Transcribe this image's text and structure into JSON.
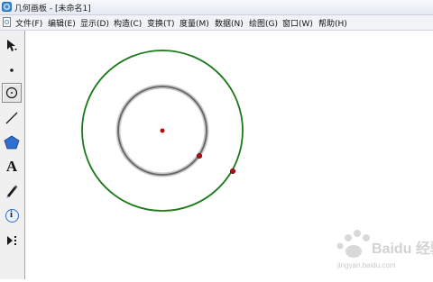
{
  "window": {
    "title": "几何画板 - [未命名1]"
  },
  "menubar": {
    "items": [
      {
        "label": "文件(F)"
      },
      {
        "label": "编辑(E)"
      },
      {
        "label": "显示(D)"
      },
      {
        "label": "构造(C)"
      },
      {
        "label": "变换(T)"
      },
      {
        "label": "度量(M)"
      },
      {
        "label": "数据(N)"
      },
      {
        "label": "绘图(G)"
      },
      {
        "label": "窗口(W)"
      },
      {
        "label": "帮助(H)"
      }
    ]
  },
  "toolbox": {
    "tools": [
      {
        "name": "selection-arrow",
        "icon": "arrow-icon"
      },
      {
        "name": "point",
        "icon": "point-icon"
      },
      {
        "name": "compass",
        "icon": "circle-icon",
        "selected": true
      },
      {
        "name": "straightedge",
        "icon": "line-icon"
      },
      {
        "name": "polygon",
        "icon": "pentagon-icon"
      },
      {
        "name": "text",
        "icon": "text-icon",
        "glyph": "A"
      },
      {
        "name": "marker",
        "icon": "pen-icon"
      },
      {
        "name": "information",
        "icon": "info-icon",
        "glyph": "i"
      },
      {
        "name": "custom",
        "icon": "custom-tool-icon"
      }
    ]
  },
  "canvas": {
    "colors": {
      "outer_circle": "#1a7a1a",
      "inner_circle": "#666666",
      "inner_halo": "#c8c8c8",
      "points": "#b01010"
    }
  },
  "watermark": {
    "brand": "Baidu 经验",
    "url": "jingyan.baidu.com"
  }
}
